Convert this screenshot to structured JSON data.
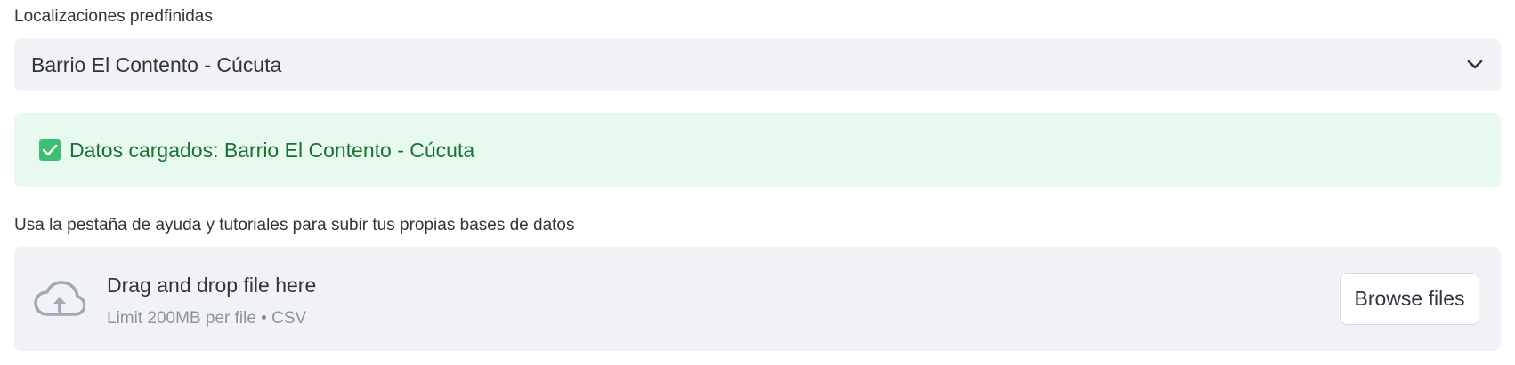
{
  "locations": {
    "label": "Localizaciones predfinidas",
    "selected": "Barrio El Contento - Cúcuta"
  },
  "success": {
    "message": "Datos cargados: Barrio El Contento - Cúcuta",
    "icon": "check-box-icon",
    "color": "#177233",
    "background": "#E8F9EE"
  },
  "upload": {
    "hint": "Usa la pestaña de ayuda y tutoriales para subir tus propias bases de datos",
    "title": "Drag and drop file here",
    "limit": "Limit 200MB per file • CSV",
    "browse_label": "Browse files",
    "icon": "cloud-upload-icon"
  }
}
